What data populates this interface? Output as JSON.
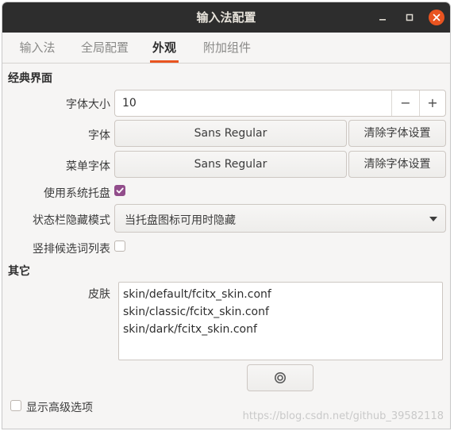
{
  "window": {
    "title": "输入法配置"
  },
  "tabs": [
    {
      "label": "输入法"
    },
    {
      "label": "全局配置"
    },
    {
      "label": "外观"
    },
    {
      "label": "附加组件"
    }
  ],
  "classic": {
    "section_title": "经典界面",
    "font_size_label": "字体大小",
    "font_size_value": "10",
    "font_size_dec": "−",
    "font_size_inc": "+",
    "font_label": "字体",
    "font_value": "Sans Regular",
    "font_clear": "清除字体设置",
    "menu_font_label": "菜单字体",
    "menu_font_value": "Sans Regular",
    "menu_font_clear": "清除字体设置",
    "tray_label": "使用系统托盘",
    "tray_checked": true,
    "statusbar_label": "状态栏隐藏模式",
    "statusbar_value": "当托盘图标可用时隐藏",
    "vertical_label": "竖排候选词列表",
    "vertical_checked": false
  },
  "other": {
    "section_title": "其它",
    "skin_label": "皮肤",
    "skins": [
      "skin/default/fcitx_skin.conf",
      "skin/classic/fcitx_skin.conf",
      "skin/dark/fcitx_skin.conf"
    ],
    "skin_config_icon": "gear-icon"
  },
  "advanced": {
    "label": "显示高级选项",
    "checked": false
  },
  "watermark": "https://blog.csdn.net/github_39582118",
  "colors": {
    "accent": "#e95420",
    "checkbox": "#924d8b",
    "titlebar": "#2d2d2d"
  }
}
